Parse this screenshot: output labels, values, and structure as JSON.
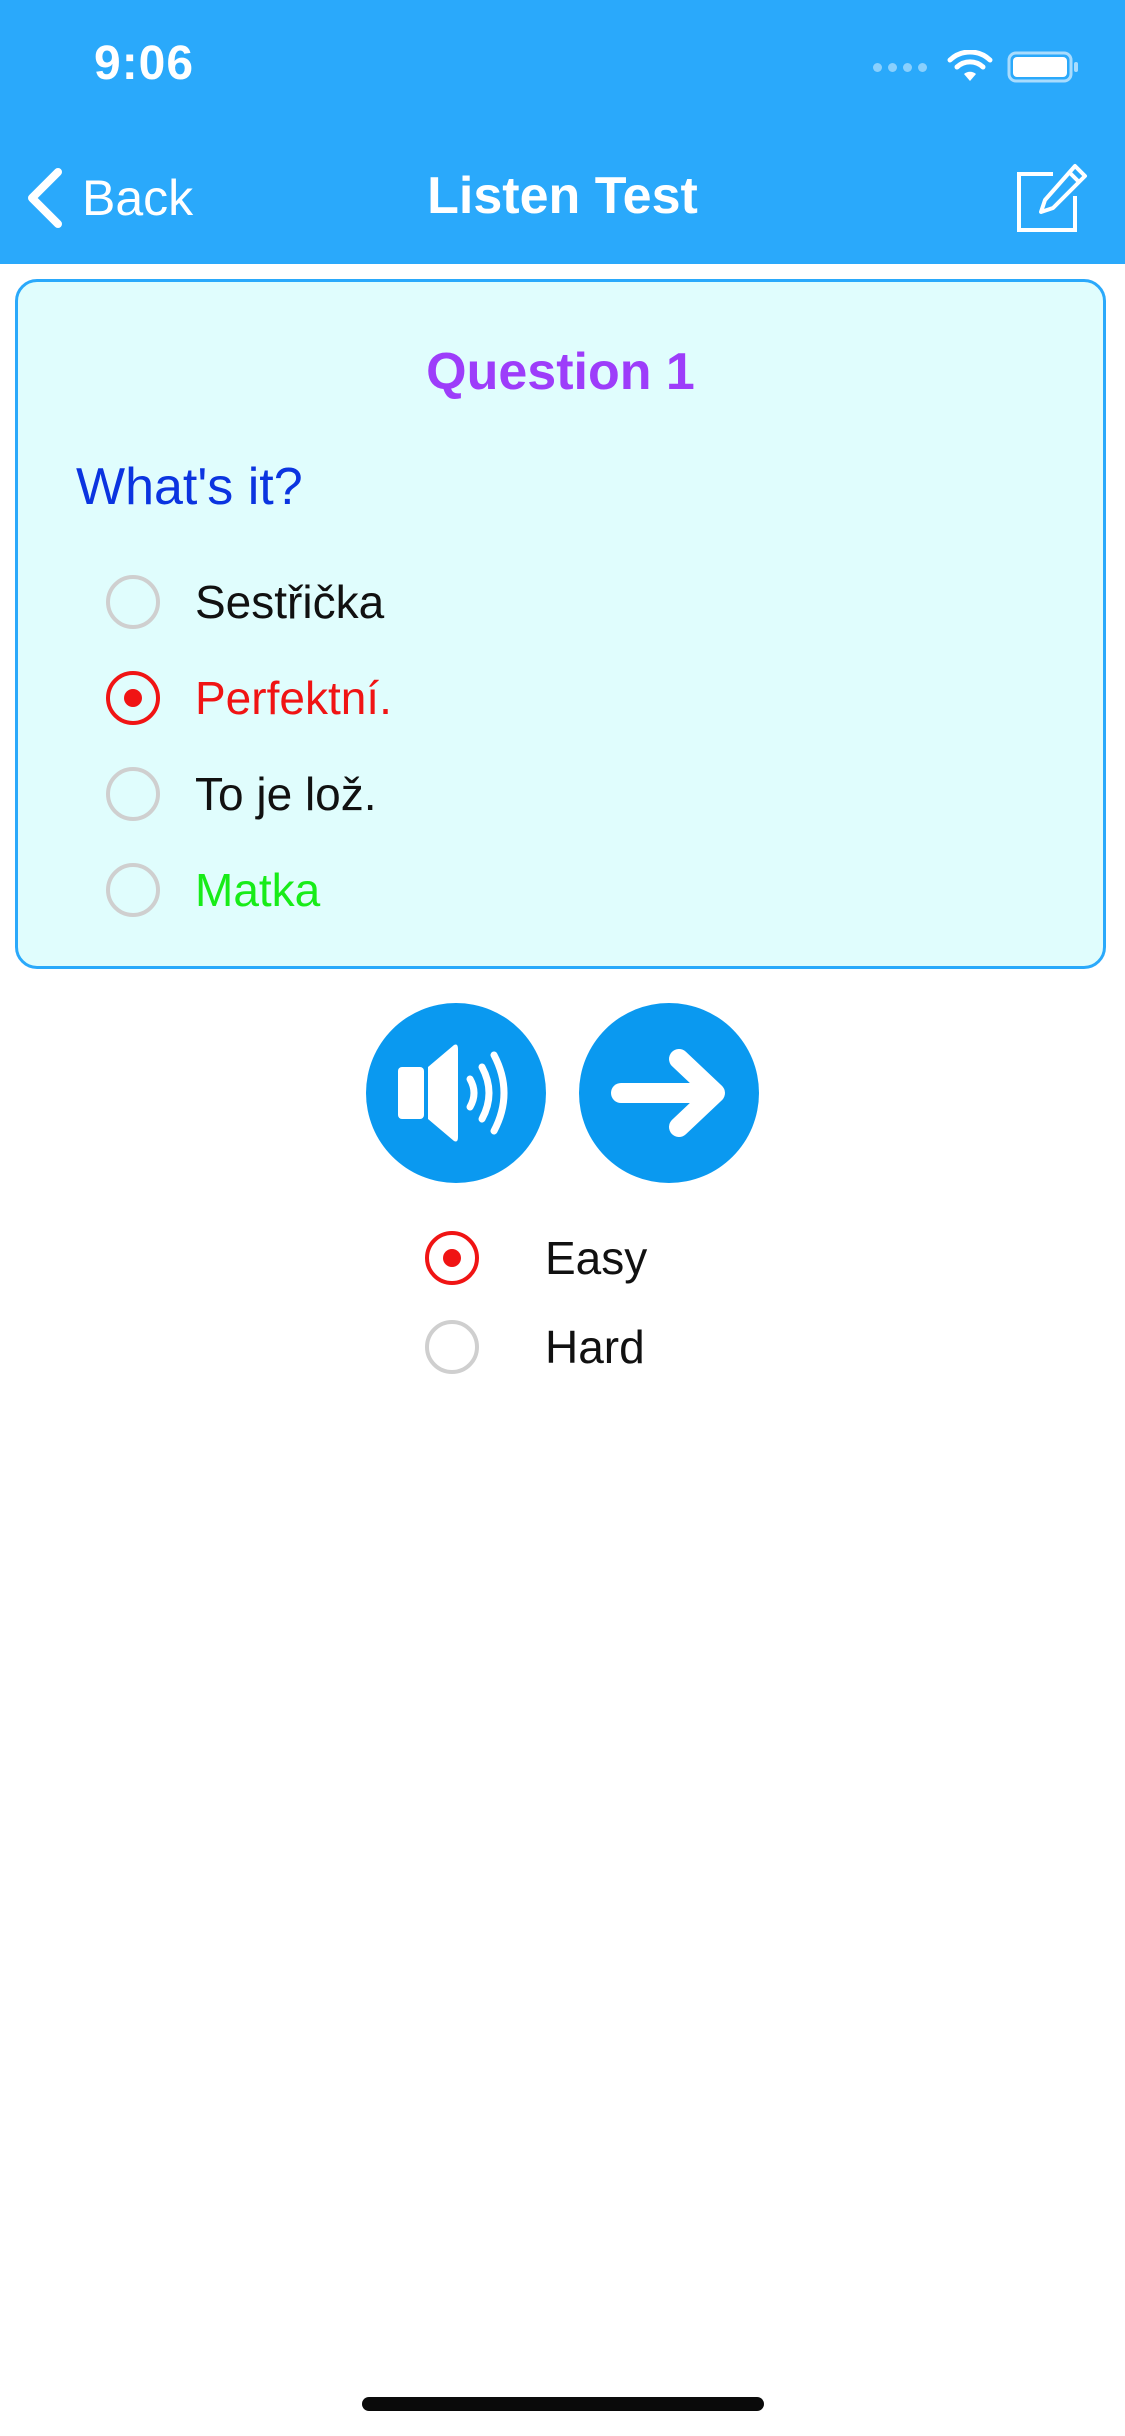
{
  "status_bar": {
    "time": "9:06"
  },
  "nav": {
    "back_label": "Back",
    "title": "Listen Test",
    "edit_icon": "compose-icon"
  },
  "question": {
    "title": "Question 1",
    "prompt": "What's it?",
    "options": [
      {
        "label": "Sestřička",
        "state": "unselected"
      },
      {
        "label": "Perfektní.",
        "state": "selected-wrong"
      },
      {
        "label": "To je lož.",
        "state": "unselected"
      },
      {
        "label": "Matka",
        "state": "correct"
      }
    ]
  },
  "actions": {
    "play_icon": "speaker-icon",
    "next_icon": "arrow-right-icon"
  },
  "difficulty": {
    "options": [
      {
        "label": "Easy",
        "selected": true
      },
      {
        "label": "Hard",
        "selected": false
      }
    ]
  },
  "colors": {
    "header": "#2aa9fb",
    "card_background": "#e0fdfd",
    "card_border": "#2aa9fb",
    "question_title": "#9d3dfa",
    "prompt": "#0b34e0",
    "wrong": "#f01414",
    "correct": "#18ec18",
    "action_button": "#0a99f0"
  }
}
